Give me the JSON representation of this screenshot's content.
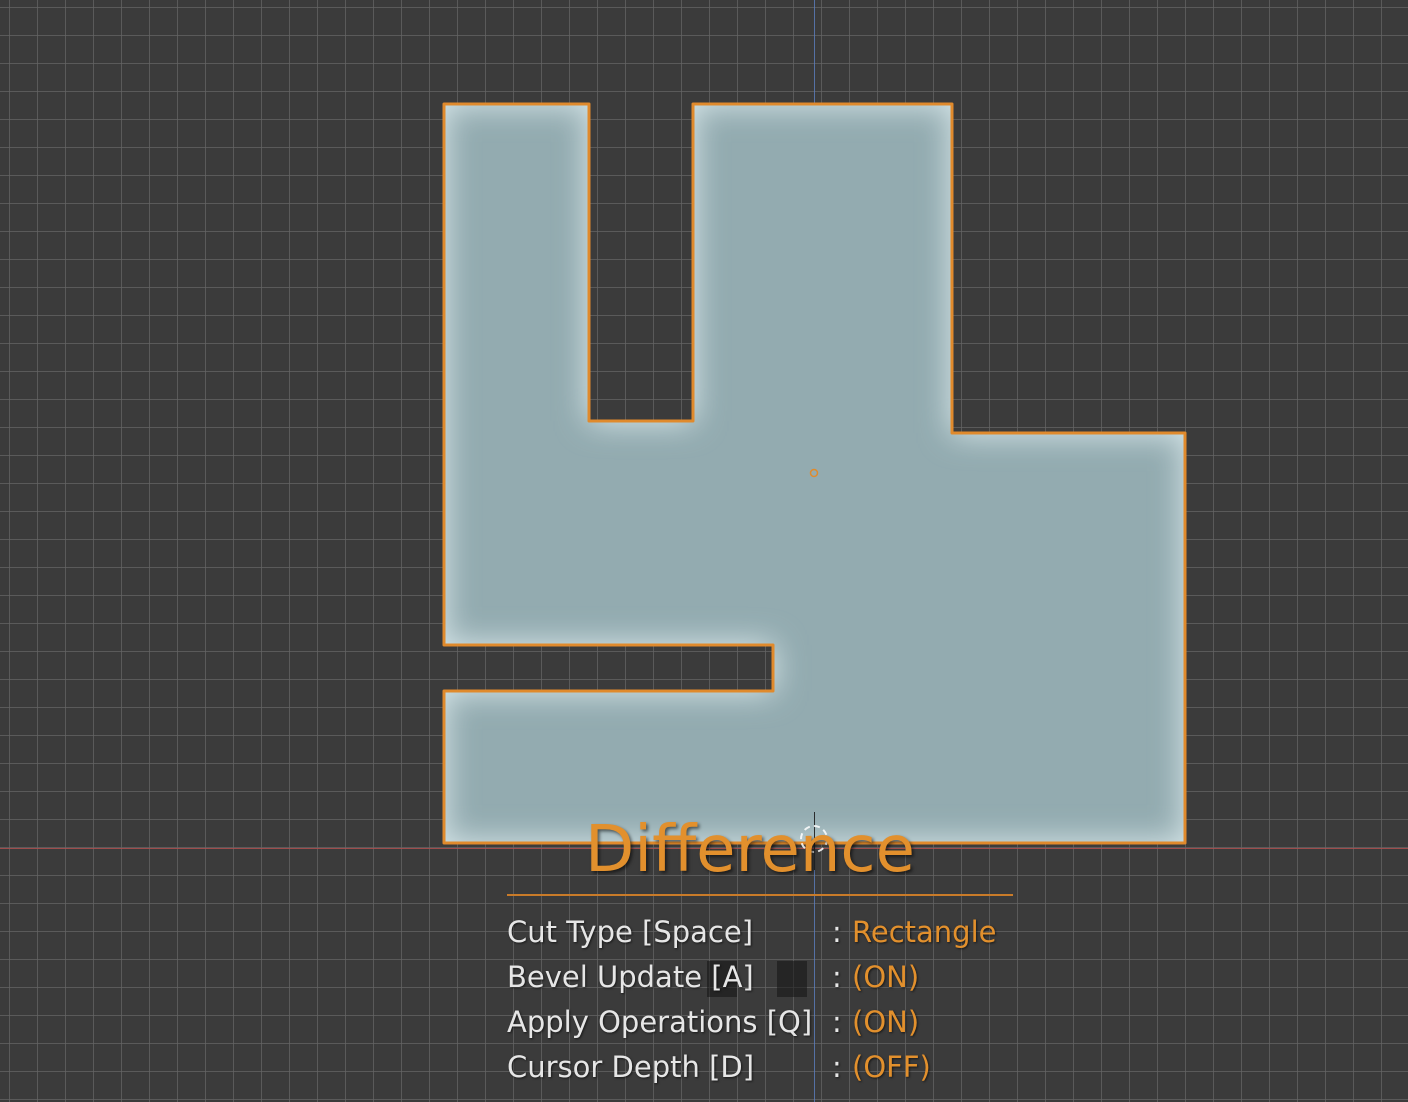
{
  "colors": {
    "viewport_background": "#3b3b3b",
    "mesh_fill": "#93abb0",
    "mesh_outline": "#e08a2c",
    "accent": "#e2902d",
    "label_text": "#e6e6e6",
    "axis_x": "#b05050",
    "axis_y": "#5a7bb8"
  },
  "icons": {
    "origin": "origin-dot-icon",
    "cursor": "3d-cursor-icon"
  },
  "hud": {
    "title": "Difference",
    "rows": [
      {
        "label": "Cut Type [Space]",
        "colon": ":",
        "value": "Rectangle"
      },
      {
        "label": "Bevel Update [A]",
        "colon": ":",
        "value": "(ON)"
      },
      {
        "label": "Apply Operations [Q]",
        "colon": ":",
        "value": "(ON)"
      },
      {
        "label": "Cursor Depth [D]",
        "colon": ":",
        "value": "(OFF)"
      }
    ]
  }
}
